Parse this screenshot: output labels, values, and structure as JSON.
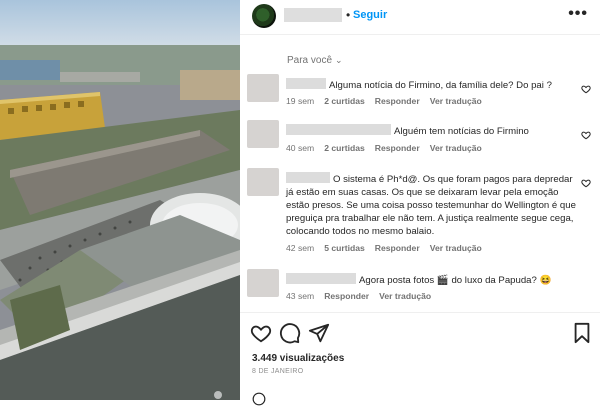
{
  "post": {
    "follow_label": "Seguir",
    "more_label": "•••",
    "dot": "•",
    "sort_label": "Para você",
    "views": "3.449 visualizações",
    "date": "8 DE JANEIRO"
  },
  "comments": [
    {
      "text": "Alguma notícia do Firmino, da família dele? Do pai ?",
      "time": "19 sem",
      "likes": "2 curtidas",
      "reply": "Responder",
      "translate": "Ver tradução"
    },
    {
      "text": "Alguém tem notícias do Firmino",
      "time": "40 sem",
      "likes": "2 curtidas",
      "reply": "Responder",
      "translate": "Ver tradução"
    },
    {
      "text": "O sistema é Ph*d@. Os que foram pagos para depredar já estão em suas casas. Os que se deixaram levar pela emoção estão presos. Se uma coisa posso testemunhar do Wellington é que preguiça pra trabalhar ele não tem. A justiça realmente segue cega, colocando todos no mesmo balaio.",
      "time": "42 sem",
      "likes": "5 curtidas",
      "reply": "Responder",
      "translate": "Ver tradução"
    },
    {
      "text": "Agora posta fotos 🎬 do luxo da Papuda? 😆",
      "time": "43 sem",
      "reply": "Responder",
      "translate": "Ver tradução"
    }
  ],
  "icons": [
    "heart-icon",
    "comment-icon",
    "share-icon",
    "bookmark-icon"
  ],
  "colors": {
    "accent": "#0095f6",
    "meta": "#737373"
  }
}
